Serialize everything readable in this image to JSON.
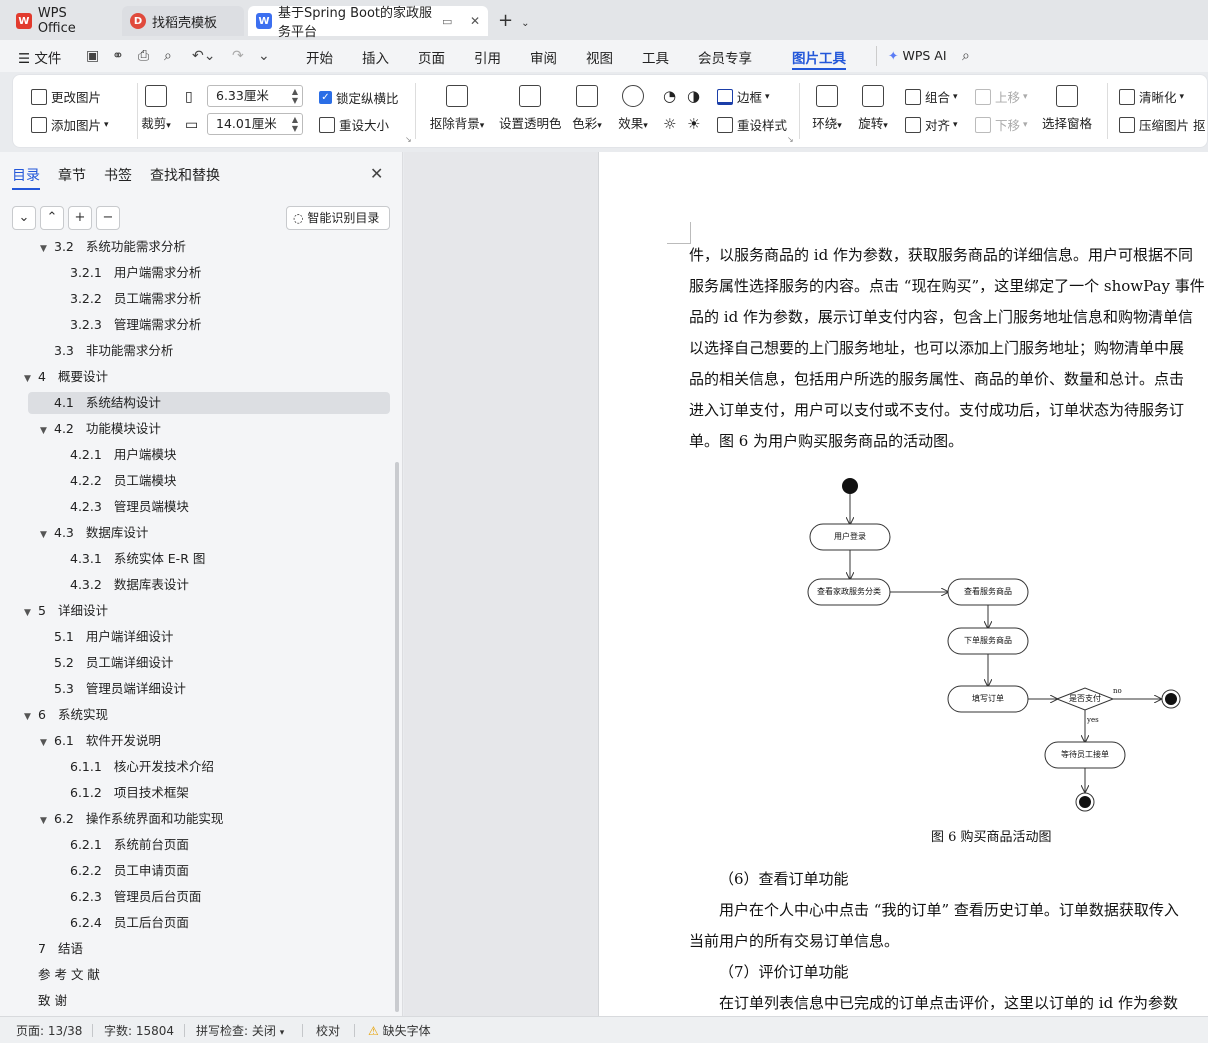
{
  "titlebar": {
    "tabs": [
      {
        "label": "WPS Office",
        "icon": "wps-logo-icon"
      },
      {
        "label": "找稻壳模板",
        "icon": "docer-logo-icon"
      },
      {
        "label": "基于Spring Boot的家政服务平台",
        "icon": "writer-logo-icon"
      }
    ],
    "add_label": "+"
  },
  "menubar": {
    "file_label": "文件",
    "items": [
      "开始",
      "插入",
      "页面",
      "引用",
      "审阅",
      "视图",
      "工具",
      "会员专享",
      "图片工具"
    ],
    "wps_ai_label": "WPS AI"
  },
  "ribbon": {
    "change_picture": "更改图片",
    "add_picture": "添加图片",
    "crop": "裁剪",
    "width_value": "6.33厘米",
    "height_value": "14.01厘米",
    "lock_ratio": "锁定纵横比",
    "reset_size": "重设大小",
    "remove_bg": "抠除背景",
    "set_transparent": "设置透明色",
    "color": "色彩",
    "effect": "效果",
    "border": "边框",
    "reset_style": "重设样式",
    "wrap": "环绕",
    "rotate": "旋转",
    "group": "组合",
    "align": "对齐",
    "move_up": "上移",
    "move_down": "下移",
    "selection_pane": "选择窗格",
    "clarify": "清晰化",
    "compress": "压缩图片",
    "more": "抠"
  },
  "sidebar": {
    "tabs": [
      "目录",
      "章节",
      "书签",
      "查找和替换"
    ],
    "smart_toc": "智能识别目录",
    "toc": [
      {
        "num": "3.2",
        "text": "系统功能需求分析",
        "level": 2,
        "expanded": true
      },
      {
        "num": "3.2.1",
        "text": "用户端需求分析",
        "level": 3
      },
      {
        "num": "3.2.2",
        "text": "员工端需求分析",
        "level": 3
      },
      {
        "num": "3.2.3",
        "text": "管理端需求分析",
        "level": 3
      },
      {
        "num": "3.3",
        "text": "非功能需求分析",
        "level": 2
      },
      {
        "num": "4",
        "text": "概要设计",
        "level": 1,
        "expanded": true
      },
      {
        "num": "4.1",
        "text": "系统结构设计",
        "level": 2,
        "selected": true
      },
      {
        "num": "4.2",
        "text": "功能模块设计",
        "level": 2,
        "expanded": true
      },
      {
        "num": "4.2.1",
        "text": "用户端模块",
        "level": 3
      },
      {
        "num": "4.2.2",
        "text": "员工端模块",
        "level": 3
      },
      {
        "num": "4.2.3",
        "text": "管理员端模块",
        "level": 3
      },
      {
        "num": "4.3",
        "text": "数据库设计",
        "level": 2,
        "expanded": true
      },
      {
        "num": "4.3.1",
        "text": "系统实体 E-R 图",
        "level": 3
      },
      {
        "num": "4.3.2",
        "text": "数据库表设计",
        "level": 3
      },
      {
        "num": "5",
        "text": "详细设计",
        "level": 1,
        "expanded": true
      },
      {
        "num": "5.1",
        "text": "用户端详细设计",
        "level": 2
      },
      {
        "num": "5.2",
        "text": "员工端详细设计",
        "level": 2
      },
      {
        "num": "5.3",
        "text": "管理员端详细设计",
        "level": 2
      },
      {
        "num": "6",
        "text": "系统实现",
        "level": 1,
        "expanded": true
      },
      {
        "num": "6.1",
        "text": "软件开发说明",
        "level": 2,
        "expanded": true
      },
      {
        "num": "6.1.1",
        "text": "核心开发技术介绍",
        "level": 3
      },
      {
        "num": "6.1.2",
        "text": "项目技术框架",
        "level": 3
      },
      {
        "num": "6.2",
        "text": "操作系统界面和功能实现",
        "level": 2,
        "expanded": true
      },
      {
        "num": "6.2.1",
        "text": "系统前台页面",
        "level": 3
      },
      {
        "num": "6.2.2",
        "text": "员工申请页面",
        "level": 3
      },
      {
        "num": "6.2.3",
        "text": "管理员后台页面",
        "level": 3
      },
      {
        "num": "6.2.4",
        "text": "员工后台页面",
        "level": 3
      },
      {
        "num": "7",
        "text": "结语",
        "level": 1
      },
      {
        "num": "",
        "text": "参 考 文 献",
        "level": 1
      },
      {
        "num": "",
        "text": "致 谢",
        "level": 1
      }
    ]
  },
  "document": {
    "lines": [
      "件，以服务商品的 id 作为参数，获取服务商品的详细信息。用户可根据不同",
      "服务属性选择服务的内容。点击 “现在购买”，这里绑定了一个 showPay 事件",
      "品的 id 作为参数，展示订单支付内容，包含上门服务地址信息和购物清单信",
      "以选择自己想要的上门服务地址，也可以添加上门服务地址；购物清单中展",
      "品的相关信息，包括用户所选的服务属性、商品的单价、数量和总计。点击",
      "进入订单支付，用户可以支付或不支付。支付成功后，订单状态为待服务订",
      "单。图 6 为用户购买服务商品的活动图。"
    ],
    "diagram": {
      "nodes": {
        "login": "用户登录",
        "browse_category": "查看家政服务分类",
        "view_goods": "查看服务商品",
        "order_goods": "下单服务商品",
        "fill_order": "填写订单",
        "pay_decision": "是否支付",
        "wait_staff": "等待员工接单"
      },
      "edge_no": "no",
      "edge_yes": "yes",
      "caption": "图 6  购买商品活动图"
    },
    "after_lines": [
      {
        "text": "（6）查看订单功能",
        "indent": 1
      },
      {
        "text": "用户在个人中心中点击 “我的订单” 查看历史订单。订单数据获取传入",
        "indent": 1
      },
      {
        "text": "当前用户的所有交易订单信息。",
        "indent": 0
      },
      {
        "text": "（7）评价订单功能",
        "indent": 1
      },
      {
        "text": "在订单列表信息中已完成的订单点击评价，这里以订单的 id 作为参数",
        "indent": 1
      }
    ]
  },
  "statusbar": {
    "page": "页面: 13/38",
    "words": "字数: 15804",
    "spell": "拼写检查: 关闭",
    "proof": "校对",
    "missing_font": "缺失字体"
  },
  "colors": {
    "accent": "#2357d9",
    "wps_red": "#e23b2e",
    "writer_blue": "#3c6ff0"
  }
}
